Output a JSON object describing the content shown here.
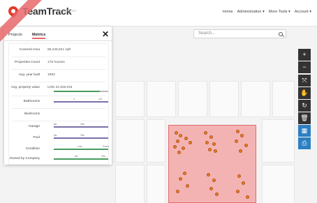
{
  "brand": {
    "name": "TeamTrack",
    "sub": "Loc analytics"
  },
  "nav": {
    "home": "Home",
    "admin": "Administration ▾",
    "tools": "More Tools ▾",
    "account": "Account ▾"
  },
  "search": {
    "placeholder": "Search..."
  },
  "panel": {
    "tabs": [
      "Projects",
      "Metrics"
    ],
    "rows": [
      {
        "label": "Covered Area",
        "value": "96,245,521 sqft",
        "type": "value"
      },
      {
        "label": "Properties Count",
        "value": "175 houses",
        "type": "value"
      },
      {
        "label": "Avg. year built",
        "value": "1993",
        "type": "value"
      },
      {
        "label": "Avg. property value",
        "value": "USD 24,328,016",
        "type": "slider",
        "fill": 0.85,
        "color": "green"
      },
      {
        "label": "Bathrooms",
        "type": "slider",
        "ticks": [
          "1",
          "4.5"
        ],
        "color": "purple"
      },
      {
        "label": "Bedrooms",
        "type": "empty"
      },
      {
        "label": "Garage",
        "type": "slider",
        "ticks": [
          "No",
          "Yes"
        ],
        "color": "purple"
      },
      {
        "label": "Pool",
        "type": "slider",
        "ticks": [
          "No",
          "Yes"
        ],
        "color": "purple"
      },
      {
        "label": "Condition",
        "type": "slider",
        "ticks": [
          "Low",
          "Good"
        ],
        "color": "green"
      },
      {
        "label": "Owned by Company",
        "type": "slider",
        "ticks": [
          "No",
          "Yes"
        ],
        "color": "green"
      }
    ]
  },
  "tools": [
    "+",
    "−",
    "⤧",
    "✋",
    "↻",
    "🗑",
    "▦",
    "⎙"
  ]
}
